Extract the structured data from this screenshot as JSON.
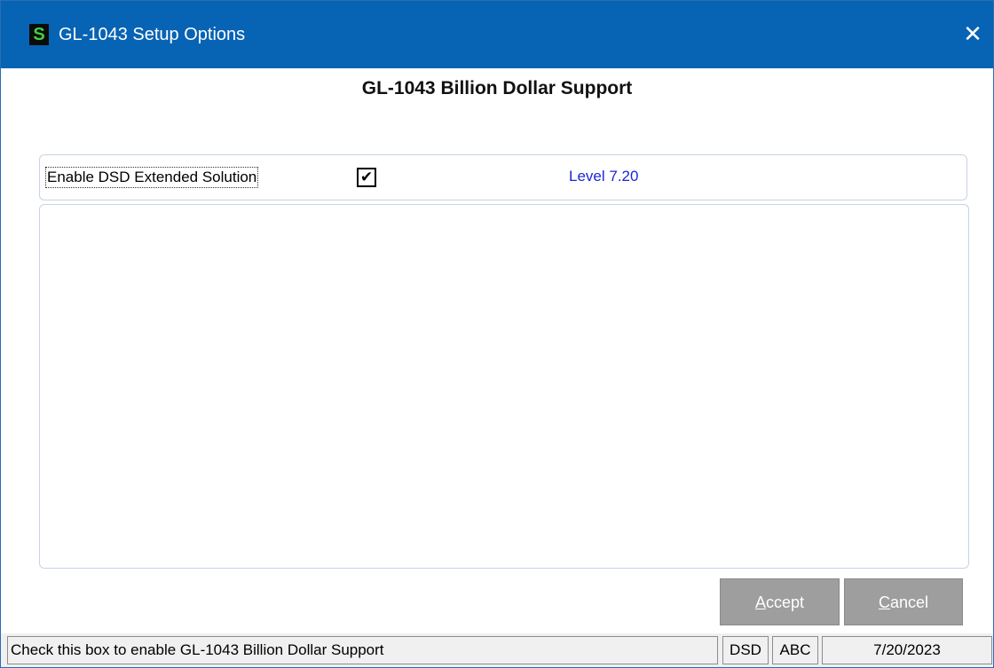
{
  "window": {
    "title": "GL-1043 Setup Options",
    "app_icon_letter": "S",
    "close_glyph": "✕"
  },
  "heading": "GL-1043 Billion Dollar Support",
  "options": {
    "enable_label": "Enable DSD Extended Solution",
    "enable_checked": true,
    "check_glyph": "✔",
    "level": "Level 7.20"
  },
  "buttons": {
    "accept_mnemonic": "A",
    "accept_rest": "ccept",
    "cancel_mnemonic": "C",
    "cancel_rest": "ancel"
  },
  "statusbar": {
    "message": "Check this box to enable GL-1043 Billion Dollar Support",
    "company1": "DSD",
    "company2": "ABC",
    "date": "7/20/2023"
  },
  "colors": {
    "titlebar": "#0763b4",
    "level_text": "#1a27d6",
    "button_disabled": "#9e9e9e"
  }
}
